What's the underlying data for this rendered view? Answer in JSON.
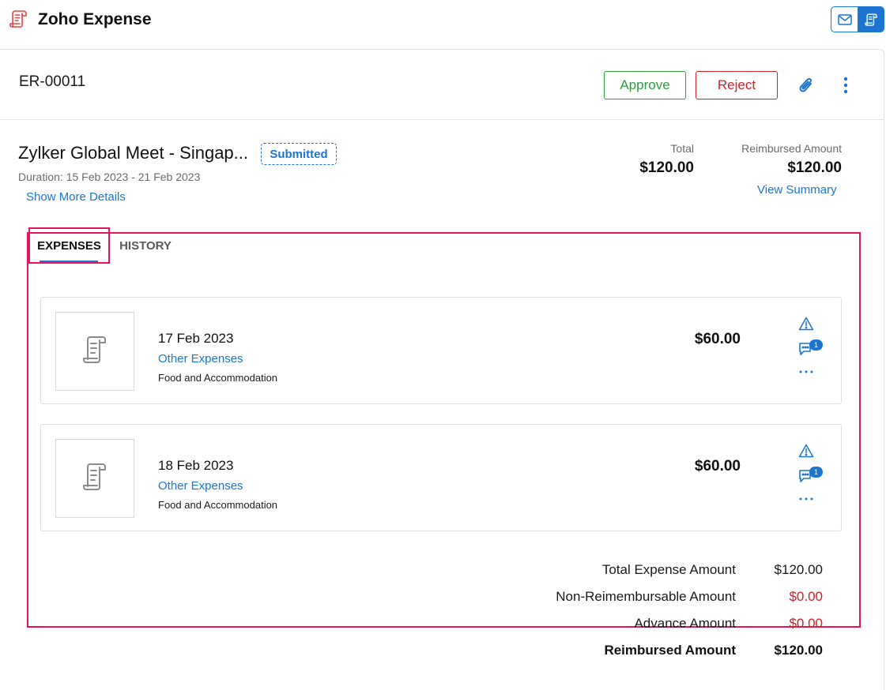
{
  "app": {
    "title": "Zoho Expense"
  },
  "icons": {
    "logo": "receipt-logo-icon",
    "mail": "mail-icon",
    "expense": "expense-app-icon",
    "attach": "paperclip-icon",
    "more": "vertical-dots-icon",
    "receipt": "receipt-icon",
    "warning": "warning-icon",
    "comment": "comment-icon",
    "dots": "horizontal-dots-icon"
  },
  "colors": {
    "accent": "#1c75d1",
    "approve": "#2c9c3c",
    "reject": "#d0202a",
    "highlight": "#e3165b",
    "logo": "#e8413f"
  },
  "report": {
    "id": "ER-00011",
    "approve_label": "Approve",
    "reject_label": "Reject",
    "name": "Zylker Global Meet - Singap...",
    "status": "Submitted",
    "duration": "Duration: 15 Feb 2023 - 21 Feb 2023",
    "show_more": "Show More Details",
    "total_label": "Total",
    "total_value": "$120.00",
    "reimbursed_label": "Reimbursed Amount",
    "reimbursed_value": "$120.00",
    "view_summary": "View Summary"
  },
  "tabs": [
    {
      "label": "EXPENSES",
      "active": true
    },
    {
      "label": "HISTORY",
      "active": false
    }
  ],
  "expenses": [
    {
      "date": "17 Feb 2023",
      "category": "Other Expenses",
      "description": "Food and Accommodation",
      "amount": "$60.00",
      "comments": "1"
    },
    {
      "date": "18 Feb 2023",
      "category": "Other Expenses",
      "description": "Food and Accommodation",
      "amount": "$60.00",
      "comments": "1"
    }
  ],
  "summary": [
    {
      "label": "Total Expense Amount",
      "value": "$120.00"
    },
    {
      "label": "Non-Reimembursable Amount",
      "value": "$0.00"
    },
    {
      "label": "Advance Amount",
      "value": "$0.00"
    },
    {
      "label": "Reimbursed Amount",
      "value": "$120.00"
    }
  ]
}
